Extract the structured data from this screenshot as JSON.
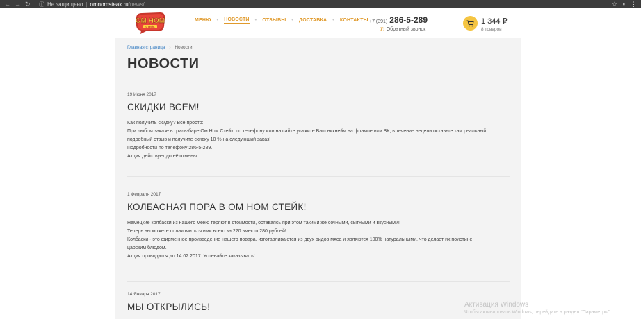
{
  "browser": {
    "security": "Не защищено",
    "host": "omnomsteak.ru",
    "path": "/news/"
  },
  "logo": {
    "line1": "ОМ НОМ",
    "line2": "СТЕЙК"
  },
  "menu": {
    "items": [
      {
        "label": "МЕНЮ",
        "active": false
      },
      {
        "label": "НОВОСТИ",
        "active": true
      },
      {
        "label": "ОТЗЫВЫ",
        "active": false
      },
      {
        "label": "ДОСТАВКА",
        "active": false
      },
      {
        "label": "КОНТАКТЫ",
        "active": false
      }
    ]
  },
  "contacts": {
    "code": "+7 (391)",
    "number": "286-5-289",
    "callback": "Обратный звонок"
  },
  "cart": {
    "total": "1 344 ₽",
    "count": "8 товаров"
  },
  "breadcrumb": {
    "home": "Главная страница",
    "current": "Новости"
  },
  "page_title": "НОВОСТИ",
  "news": [
    {
      "date": "19 Июня 2017",
      "title": "СКИДКИ ВСЕМ!",
      "lines": [
        "Как получить скидку? Все просто:",
        "При любом заказе в гриль-баре Ом Ном Стейк, по телефону или на сайте укажите Ваш никнейм на флампе или ВК, в течение недели оставьте там реальный",
        "подробный отзыв и получите скидку 10 % на следующий заказ!",
        "Подробности по телефону 286-5-289.",
        "Акция действует до её отмены."
      ]
    },
    {
      "date": "1 Февраля 2017",
      "title": "КОЛБАСНАЯ ПОРА В ОМ НОМ СТЕЙК!",
      "lines": [
        "Немецкие колбаски из нашего меню теряют в стоимости, оставаясь при этом такими же сочными, сытными и вкусными!",
        "Теперь вы можете полакомиться ими всего за 220 вместо 280 рублей!",
        "Колбаски - это фирменное произведение нашего повара, изготавливаются из двух видов мяса и являются 100% натуральными, что делает их поистине",
        "царским блюдом.",
        "Акция проводится до 14.02.2017. Успевайте заказывать!"
      ]
    },
    {
      "date": "14 Января 2017",
      "title": "МЫ ОТКРЫЛИСЬ!",
      "lines": []
    }
  ],
  "watermark": {
    "title": "Активация Windows",
    "text": "Чтобы активировать Windows, перейдите в раздел \"Параметры\"."
  },
  "colors": {
    "accent": "#e09a2c",
    "link": "#3a7fc2",
    "content_bg": "#f3f3f3",
    "cart_bg": "#f5c542"
  }
}
